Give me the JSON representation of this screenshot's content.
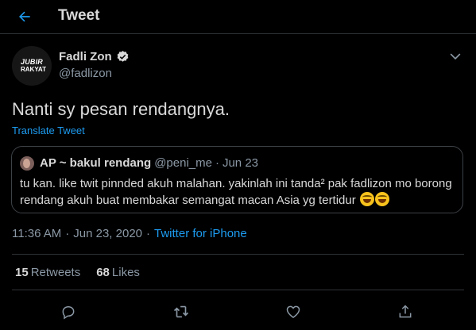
{
  "header": {
    "title": "Tweet",
    "back_icon": "arrow-left-icon"
  },
  "author": {
    "name": "Fadli Zon",
    "handle": "@fadlizon",
    "verified_icon": "verified-badge-icon",
    "avatar_text_line1": "JUBIR",
    "avatar_text_line2": "RAKYAT"
  },
  "tweet": {
    "text": "Nanti sy pesan rendangnya.",
    "translate_label": "Translate Tweet"
  },
  "quoted": {
    "name": "AP ~ bakul rendang",
    "handle": "@peni_me",
    "separator": "·",
    "date": "Jun 23",
    "text": "tu kan. like twit pinnded akuh malahan. yakinlah ini tanda² pak fadlizon mo borong rendang akuh buat membakar semangat macan Asia yg tertidur"
  },
  "meta": {
    "time": "11:36 AM",
    "separator": "·",
    "date": "Jun 23, 2020",
    "source": "Twitter for iPhone"
  },
  "stats": {
    "retweets_count": "15",
    "retweets_label": "Retweets",
    "likes_count": "68",
    "likes_label": "Likes"
  },
  "colors": {
    "accent": "#1d9bf0",
    "background": "#000000",
    "secondary_text": "#8b98a5",
    "border": "#2f3336"
  }
}
